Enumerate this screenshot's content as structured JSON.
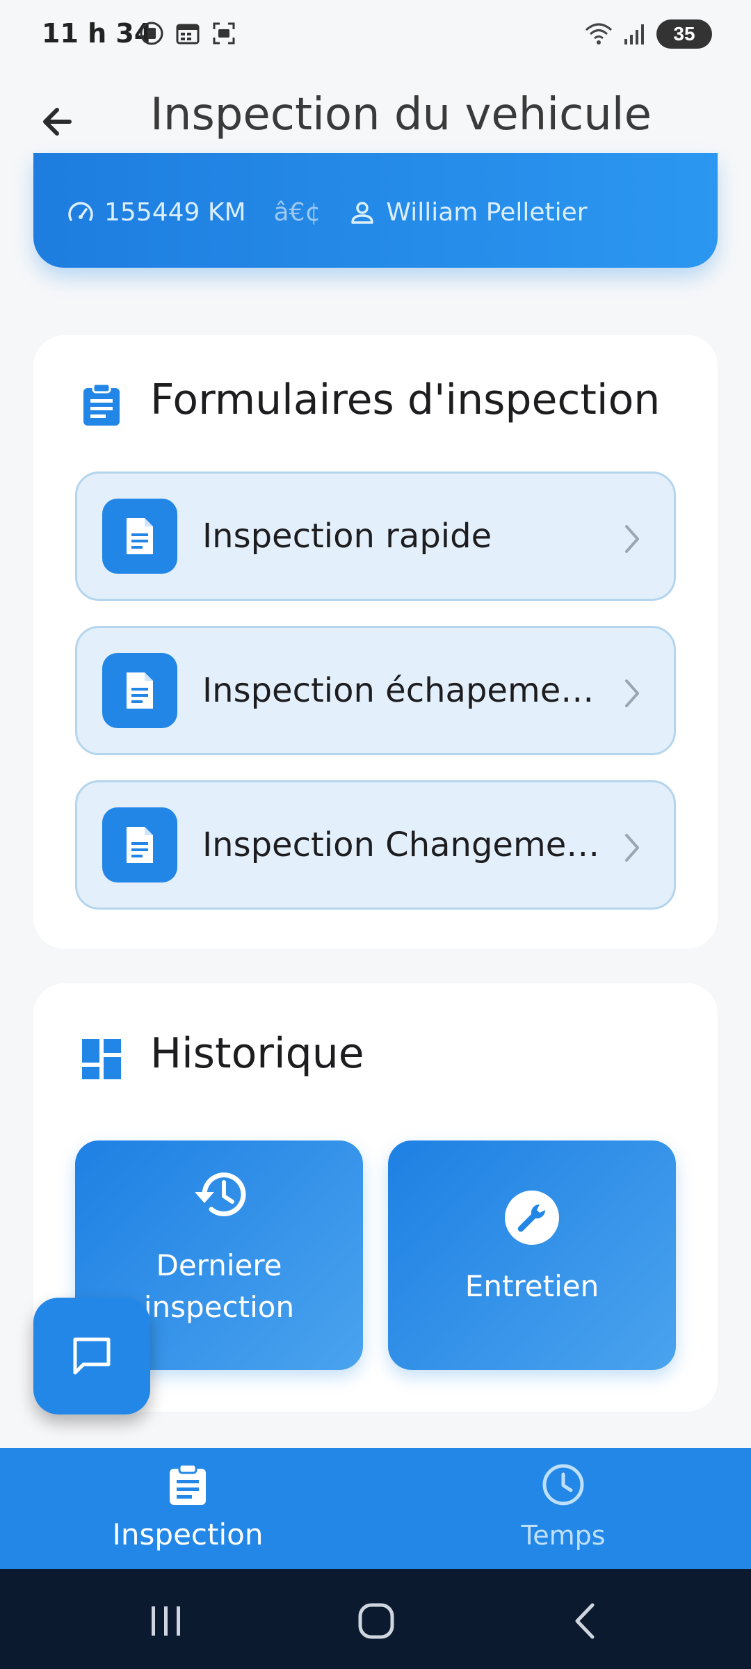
{
  "status_bar": {
    "time": "11 h 34",
    "battery": "35"
  },
  "app_bar": {
    "title": "Inspection du vehicule"
  },
  "info_card": {
    "odometer": "155449 KM",
    "separator": "â€¢",
    "driver": "William Pelletier"
  },
  "forms": {
    "title": "Formulaires d'inspection",
    "items": [
      {
        "label": "Inspection rapide"
      },
      {
        "label": "Inspection échapemen..."
      },
      {
        "label": "Inspection Changemen..."
      }
    ]
  },
  "history": {
    "title": "Historique",
    "tiles": [
      {
        "label_line1": "Derniere",
        "label_line2": "inspection"
      },
      {
        "label": "Entretien"
      }
    ]
  },
  "bottom_nav": {
    "items": [
      {
        "label": "Inspection"
      },
      {
        "label": "Temps"
      }
    ]
  },
  "colors": {
    "primary": "#2287e6",
    "tile_bg": "#e3f0fc",
    "tile_border": "#b4d5ee",
    "system_nav": "#0b1a2e"
  },
  "icons": {
    "back": "arrow-left-icon",
    "odometer": "speedometer-icon",
    "driver": "person-icon",
    "forms": "clipboard-icon",
    "form_item": "document-icon",
    "chevron": "chevron-right-icon",
    "history": "dashboard-icon",
    "last_inspection": "history-icon",
    "maintenance": "wrench-icon",
    "chat": "chat-icon",
    "nav_inspection": "clipboard-icon",
    "nav_time": "clock-icon"
  }
}
